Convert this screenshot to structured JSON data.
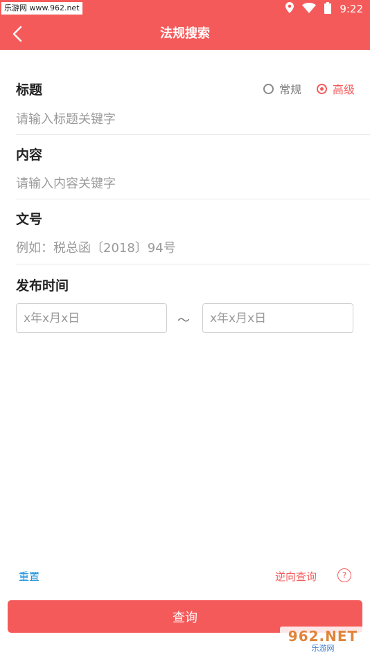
{
  "status_bar": {
    "watermark": "乐游网 www.962.net",
    "time": "9:22"
  },
  "header": {
    "title": "法规搜索"
  },
  "search_mode": {
    "options": [
      {
        "label": "常规",
        "selected": false
      },
      {
        "label": "高级",
        "selected": true
      }
    ]
  },
  "fields": {
    "title": {
      "label": "标题",
      "placeholder": "请输入标题关键字",
      "value": ""
    },
    "content": {
      "label": "内容",
      "placeholder": "请输入内容关键字",
      "value": ""
    },
    "doc_no": {
      "label": "文号",
      "placeholder": "例如：税总函〔2018〕94号",
      "value": ""
    },
    "publish_time": {
      "label": "发布时间",
      "start_placeholder": "x年x月x日",
      "end_placeholder": "x年x月x日",
      "separator": "～"
    }
  },
  "actions": {
    "reset_label": "重置",
    "reverse_label": "逆向查询",
    "help_label": "?",
    "submit_label": "查询"
  },
  "watermark_bottom": {
    "main": "962.NET",
    "sub": "乐游网"
  },
  "colors": {
    "accent": "#f55a5a",
    "link": "#1d8fd9"
  }
}
